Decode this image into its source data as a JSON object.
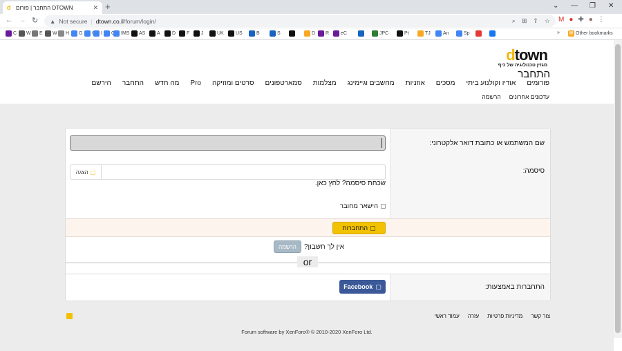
{
  "browser": {
    "tab_title": "התחבר | פורום DTOWN",
    "window_controls": [
      "⌄",
      "—",
      "❐",
      "✕"
    ],
    "nav": {
      "back": "←",
      "forward": "→",
      "reload": "↻"
    },
    "security_label": "Not secure",
    "url_host": "dtown.co.il",
    "url_path": "/forum/login/",
    "bookmarks": [
      {
        "label": "C",
        "color": "#6a1b9a"
      },
      {
        "label": "W",
        "color": "#555555"
      },
      {
        "label": "E",
        "color": "#777777"
      },
      {
        "label": "W",
        "color": "#555555"
      },
      {
        "label": "H",
        "color": "#888888"
      },
      {
        "label": "G",
        "color": "#4285f4"
      },
      {
        "label": "G",
        "color": "#4285f4"
      },
      {
        "label": "I",
        "color": "#4285f4"
      },
      {
        "label": "G",
        "color": "#4285f4"
      },
      {
        "label": "IMS",
        "color": "#4285f4"
      },
      {
        "label": "AS",
        "color": "#111111"
      },
      {
        "label": "A",
        "color": "#111111"
      },
      {
        "label": "D",
        "color": "#111111"
      },
      {
        "label": "F",
        "color": "#111111"
      },
      {
        "label": "J",
        "color": "#111111"
      },
      {
        "label": "UK",
        "color": "#111111"
      },
      {
        "label": "US",
        "color": "#111111"
      },
      {
        "label": "B",
        "color": "#1565c0"
      },
      {
        "label": "S",
        "color": "#1565c0"
      },
      {
        "label": "",
        "color": "#111111"
      },
      {
        "label": "D",
        "color": "#f9a825"
      },
      {
        "label": "R",
        "color": "#6a1b9a"
      },
      {
        "label": "eC",
        "color": "#6a1b9a"
      },
      {
        "label": "",
        "color": "#1565c0"
      },
      {
        "label": "JPC",
        "color": "#2e7d32"
      },
      {
        "label": "Pt",
        "color": "#111111"
      },
      {
        "label": "TJ",
        "color": "#f9a825"
      },
      {
        "label": "An",
        "color": "#4285f4"
      },
      {
        "label": "Sp",
        "color": "#4285f4"
      },
      {
        "label": "",
        "color": "#e53935"
      },
      {
        "label": "",
        "color": "#1877f2"
      }
    ],
    "bookmarks_overflow": "»",
    "other_bookmarks": "Other bookmarks"
  },
  "site": {
    "logo_text_a": "d",
    "logo_text_b": "town",
    "logo_tagline": "מגזין טכנולוגיה של כיף",
    "nav": [
      {
        "label": "פורומים"
      },
      {
        "label": "אודיו וקולנוע ביתי"
      },
      {
        "label": "מסכים"
      },
      {
        "label": "אוזניות"
      },
      {
        "label": "מחשבים וגיימינג"
      },
      {
        "label": "מצלמות"
      },
      {
        "label": "סמארטפונים"
      },
      {
        "label": "סרטים ומוזיקה"
      },
      {
        "label": "Pro"
      },
      {
        "label": "מה חדש"
      },
      {
        "label": "התחבר"
      },
      {
        "label": "הירשם"
      }
    ],
    "subnav": [
      "עדכונים אחרונים",
      "הרשמה"
    ]
  },
  "login": {
    "title": "התחבר",
    "username_label": "שם המשתמש או כתובת דואר אלקטרוני:",
    "password_label": "סיסמה:",
    "show_label": "הצגה",
    "forgot": "שכחת סיסמה? לחץ כאן.",
    "remember": "הישאר מחובר",
    "submit": "התחברות",
    "no_account": "אין לך חשבון?",
    "register": "הרשמה",
    "or": "or",
    "social_label": "התחברות באמצעות:",
    "facebook": "Facebook"
  },
  "footer": {
    "links": [
      "צור קשר",
      "מדיניות פרטיות",
      "עזרה",
      "עמוד ראשי"
    ],
    "credit": "Forum software by XenForo® © 2010-2020 XenForo Ltd."
  }
}
